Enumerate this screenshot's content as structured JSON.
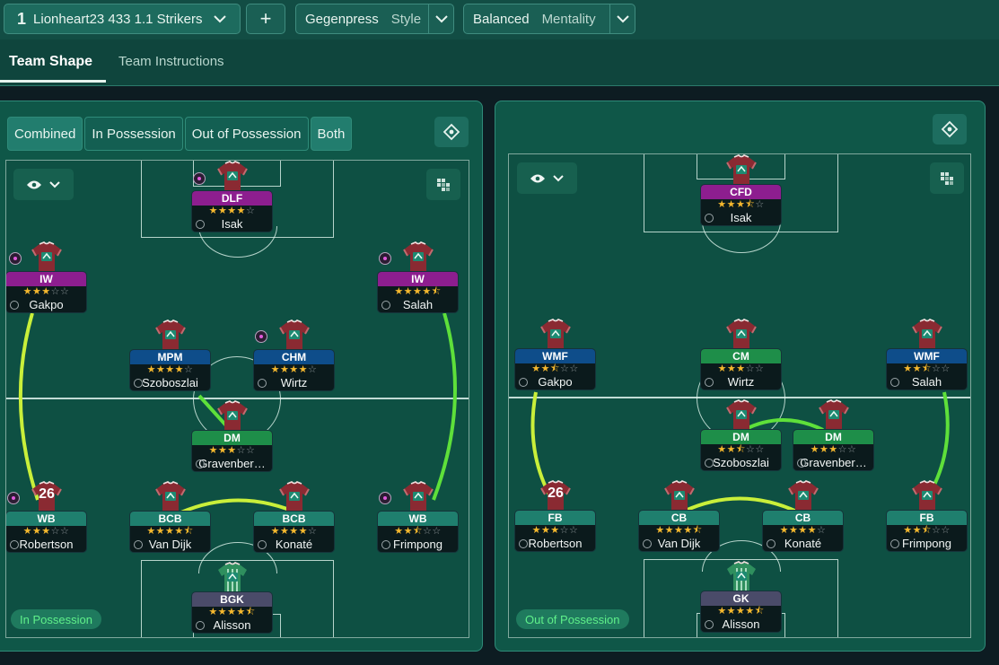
{
  "topbar": {
    "tactic_number": "1",
    "tactic_name": "Lionheart23 433 1.1 Strikers",
    "add_label": "+",
    "style_value": "Gegenpress",
    "style_label": "Style",
    "mentality_value": "Balanced",
    "mentality_label": "Mentality"
  },
  "tabs": [
    {
      "label": "Team Shape",
      "active": true
    },
    {
      "label": "Team Instructions",
      "active": false
    }
  ],
  "phase_buttons": [
    "Combined",
    "In Possession",
    "Out of Possession",
    "Both"
  ],
  "colors": {
    "attack_role": "#8d1e8f",
    "mid_role": "#0e4d8a",
    "def_mid_role": "#1e8e49",
    "back_role": "#1f7f6e",
    "gk_role": "#4a4b69",
    "link_yellow": "#c9ef3a",
    "link_green": "#5ee03a"
  },
  "in_possession": {
    "phase_tag": "In Possession",
    "players": [
      {
        "id": "isak",
        "role": "DLF",
        "name": "Isak",
        "stars": 4,
        "role_class": "attack",
        "badge": true
      },
      {
        "id": "gakpo",
        "role": "IW",
        "name": "Gakpo",
        "stars": 3,
        "role_class": "attack",
        "badge": true
      },
      {
        "id": "salah",
        "role": "IW",
        "name": "Salah",
        "stars": 4.5,
        "role_class": "attack",
        "badge": true
      },
      {
        "id": "szoboszlai",
        "role": "MPM",
        "name": "Szoboszlai",
        "stars": 4,
        "role_class": "mid",
        "badge": false
      },
      {
        "id": "wirtz",
        "role": "CHM",
        "name": "Wirtz",
        "stars": 4,
        "role_class": "mid",
        "badge": true
      },
      {
        "id": "gravenberch",
        "role": "DM",
        "name": "Gravenber…",
        "stars": 3,
        "role_class": "dm",
        "badge": false
      },
      {
        "id": "robertson",
        "role": "WB",
        "name": "Robertson",
        "stars": 3,
        "role_class": "back",
        "badge": true,
        "shirt_number": "26"
      },
      {
        "id": "vandijk",
        "role": "BCB",
        "name": "Van Dijk",
        "stars": 4.5,
        "role_class": "back",
        "badge": false
      },
      {
        "id": "konate",
        "role": "BCB",
        "name": "Konaté",
        "stars": 4,
        "role_class": "back",
        "badge": false
      },
      {
        "id": "frimpong",
        "role": "WB",
        "name": "Frimpong",
        "stars": 2.5,
        "role_class": "back",
        "badge": true
      },
      {
        "id": "alisson",
        "role": "BGK",
        "name": "Alisson",
        "stars": 4.5,
        "role_class": "gk",
        "badge": false,
        "keeper": true
      }
    ]
  },
  "out_of_possession": {
    "phase_tag": "Out of Possession",
    "players": [
      {
        "id": "isak",
        "role": "CFD",
        "name": "Isak",
        "stars": 3.5,
        "role_class": "attack",
        "badge": false
      },
      {
        "id": "gakpo",
        "role": "WMF",
        "name": "Gakpo",
        "stars": 2.5,
        "role_class": "mid",
        "badge": false
      },
      {
        "id": "wirtz",
        "role": "CM",
        "name": "Wirtz",
        "stars": 3,
        "role_class": "dm",
        "badge": false
      },
      {
        "id": "salah",
        "role": "WMF",
        "name": "Salah",
        "stars": 2.5,
        "role_class": "mid",
        "badge": false
      },
      {
        "id": "szoboszlai",
        "role": "DM",
        "name": "Szoboszlai",
        "stars": 2.5,
        "role_class": "dm",
        "badge": false
      },
      {
        "id": "gravenberch",
        "role": "DM",
        "name": "Gravenber…",
        "stars": 3,
        "role_class": "dm",
        "badge": false
      },
      {
        "id": "robertson",
        "role": "FB",
        "name": "Robertson",
        "stars": 3,
        "role_class": "back",
        "badge": false,
        "shirt_number": "26"
      },
      {
        "id": "vandijk",
        "role": "CB",
        "name": "Van Dijk",
        "stars": 4.5,
        "role_class": "back",
        "badge": false
      },
      {
        "id": "konate",
        "role": "CB",
        "name": "Konaté",
        "stars": 4,
        "role_class": "back",
        "badge": false
      },
      {
        "id": "frimpong",
        "role": "FB",
        "name": "Frimpong",
        "stars": 2.5,
        "role_class": "back",
        "badge": false
      },
      {
        "id": "alisson",
        "role": "GK",
        "name": "Alisson",
        "stars": 4.5,
        "role_class": "gk",
        "badge": false,
        "keeper": true
      }
    ]
  }
}
